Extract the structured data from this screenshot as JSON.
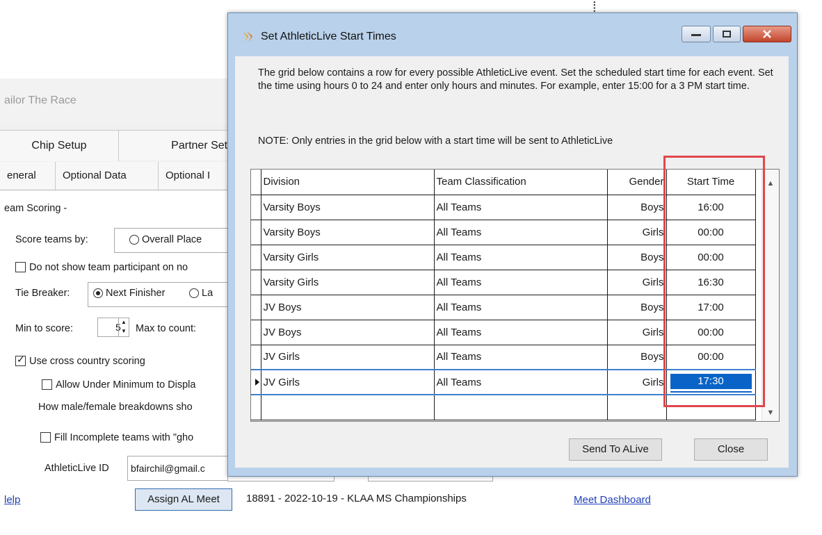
{
  "background_window": {
    "title": "ailor The Race",
    "tabs_row1": [
      "Chip Setup",
      "Partner Setu"
    ],
    "tabs_row2": [
      "eneral",
      "Optional Data",
      "Optional I"
    ],
    "team_scoring_heading": "eam Scoring -",
    "score_teams_by_label": "Score teams by:",
    "overall_place_option": "Overall Place",
    "do_not_show_label": "Do not show team participant on no",
    "tie_breaker_label": "Tie Breaker:",
    "next_finisher_option": "Next Finisher",
    "tie_breaker_other": "La",
    "min_to_score_label": "Min to score:",
    "min_to_score_value": "5",
    "max_to_count_label": "Max to count:",
    "use_cross_country_label": "Use cross country scoring",
    "allow_under_minimum_label": "Allow Under Minimum to Displa",
    "breakdowns_label": "How male/female breakdowns sho",
    "fill_incomplete_label": "Fill Incomplete teams with \"gho",
    "athleticlive_id_label": "AthleticLive ID",
    "athleticlive_id_value": "bfairchil@gmail.c",
    "help_link": "lelp",
    "assign_button": "Assign AL Meet",
    "meet_info": "18891 - 2022-10-19 - KLAA MS Championships",
    "dashboard_link": "Meet Dashboard"
  },
  "dialog": {
    "title": "Set AthleticLive Start Times",
    "instructions": "The grid below contains a row for every possible AthleticLive event. Set the scheduled start time for each event.  Set the time using hours 0 to 24 and enter only hours and minutes.  For example, enter 15:00 for a 3 PM start time.",
    "note": "NOTE: Only entries in the grid below with a start time will be sent to AthleticLive",
    "columns": [
      "Division",
      "Team Classification",
      "Gender",
      "Start Time"
    ],
    "rows": [
      {
        "division": "Varsity Boys",
        "classification": "All Teams",
        "gender": "Boys",
        "start": "16:00"
      },
      {
        "division": "Varsity Boys",
        "classification": "All Teams",
        "gender": "Girls",
        "start": "00:00"
      },
      {
        "division": "Varsity Girls",
        "classification": "All Teams",
        "gender": "Boys",
        "start": "00:00"
      },
      {
        "division": "Varsity Girls",
        "classification": "All Teams",
        "gender": "Girls",
        "start": "16:30"
      },
      {
        "division": "JV Boys",
        "classification": "All Teams",
        "gender": "Boys",
        "start": "17:00"
      },
      {
        "division": "JV Boys",
        "classification": "All Teams",
        "gender": "Girls",
        "start": "00:00"
      },
      {
        "division": "JV Girls",
        "classification": "All Teams",
        "gender": "Boys",
        "start": "00:00"
      },
      {
        "division": "JV Girls",
        "classification": "All Teams",
        "gender": "Girls",
        "start": "17:30"
      }
    ],
    "send_button": "Send To ALive",
    "close_button": "Close"
  },
  "colors": {
    "highlight": "#e0474c",
    "selection": "#0a64c8",
    "link": "#1f3fb7"
  }
}
